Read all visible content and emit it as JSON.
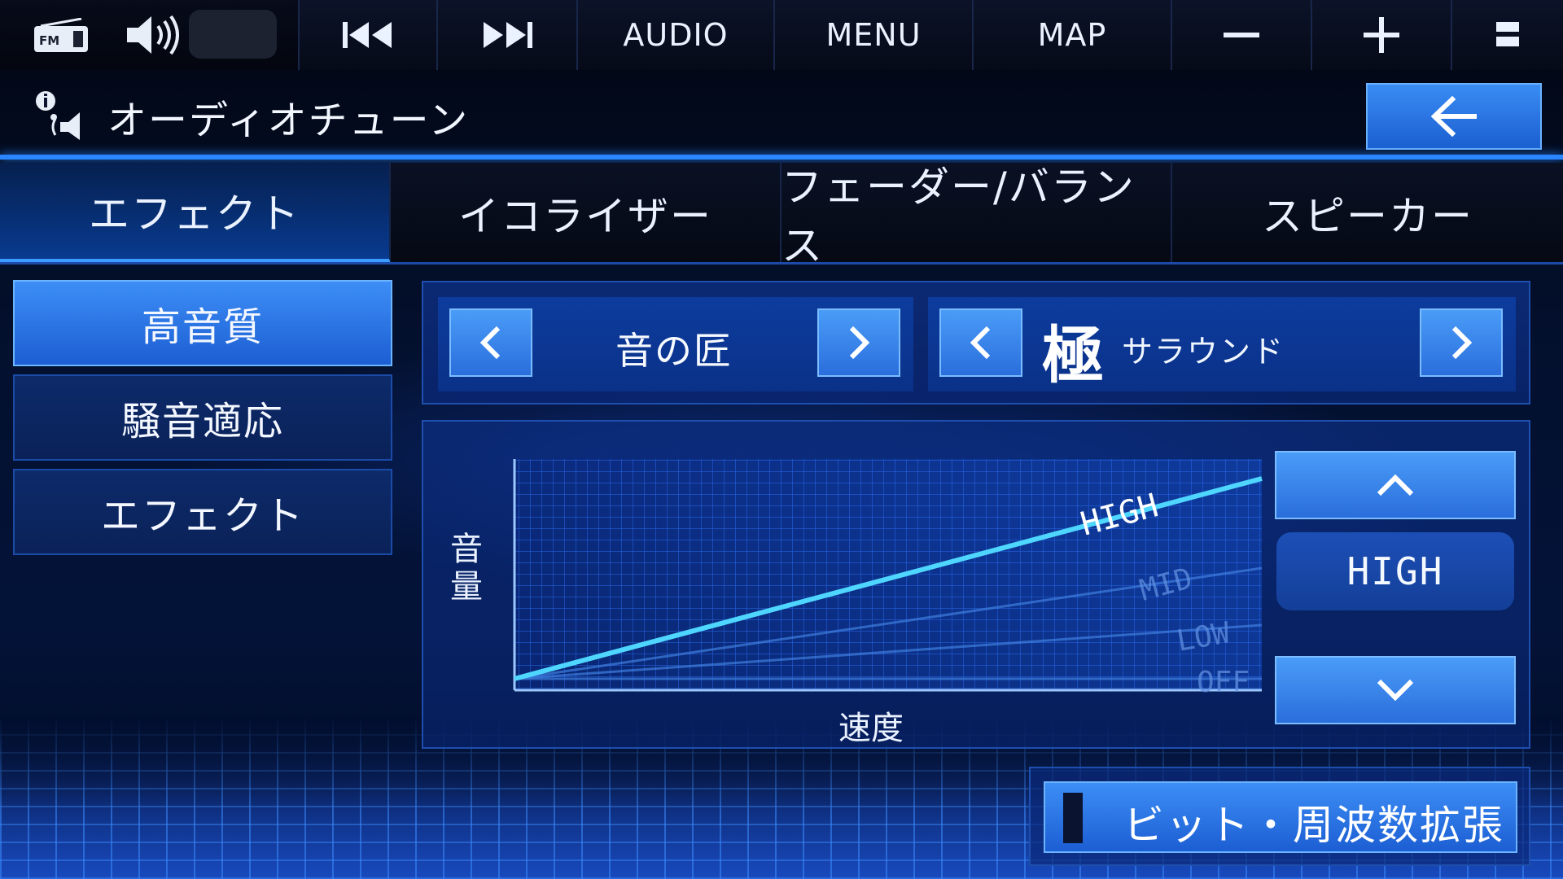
{
  "topbar": {
    "source_badge": "FM",
    "buttons": {
      "audio": "AUDIO",
      "menu": "MENU",
      "map": "MAP"
    }
  },
  "title": {
    "text": "オーディオチューン"
  },
  "tabs": [
    {
      "label": "エフェクト",
      "active": true
    },
    {
      "label": "イコライザー",
      "active": false
    },
    {
      "label": "フェーダー/バランス",
      "active": false
    },
    {
      "label": "スピーカー",
      "active": false
    }
  ],
  "menu": [
    {
      "label": "高音質",
      "active": true
    },
    {
      "label": "騒音適応",
      "active": false
    },
    {
      "label": "エフェクト",
      "active": false
    }
  ],
  "selector": {
    "preset": "音の匠",
    "surround_mark": "極",
    "surround_label": "サラウンド"
  },
  "graph": {
    "y_label": "音量",
    "x_label": "速度",
    "curves": [
      "HIGH",
      "MID",
      "LOW",
      "OFF"
    ],
    "selected_curve": "HIGH"
  },
  "level": {
    "value": "HIGH"
  },
  "bit_expansion": {
    "label": "ビット・周波数拡張"
  },
  "colors": {
    "accent": "#2a86ff",
    "button_fill": "#2a6edc",
    "graph_line": "#4fd6ff"
  }
}
